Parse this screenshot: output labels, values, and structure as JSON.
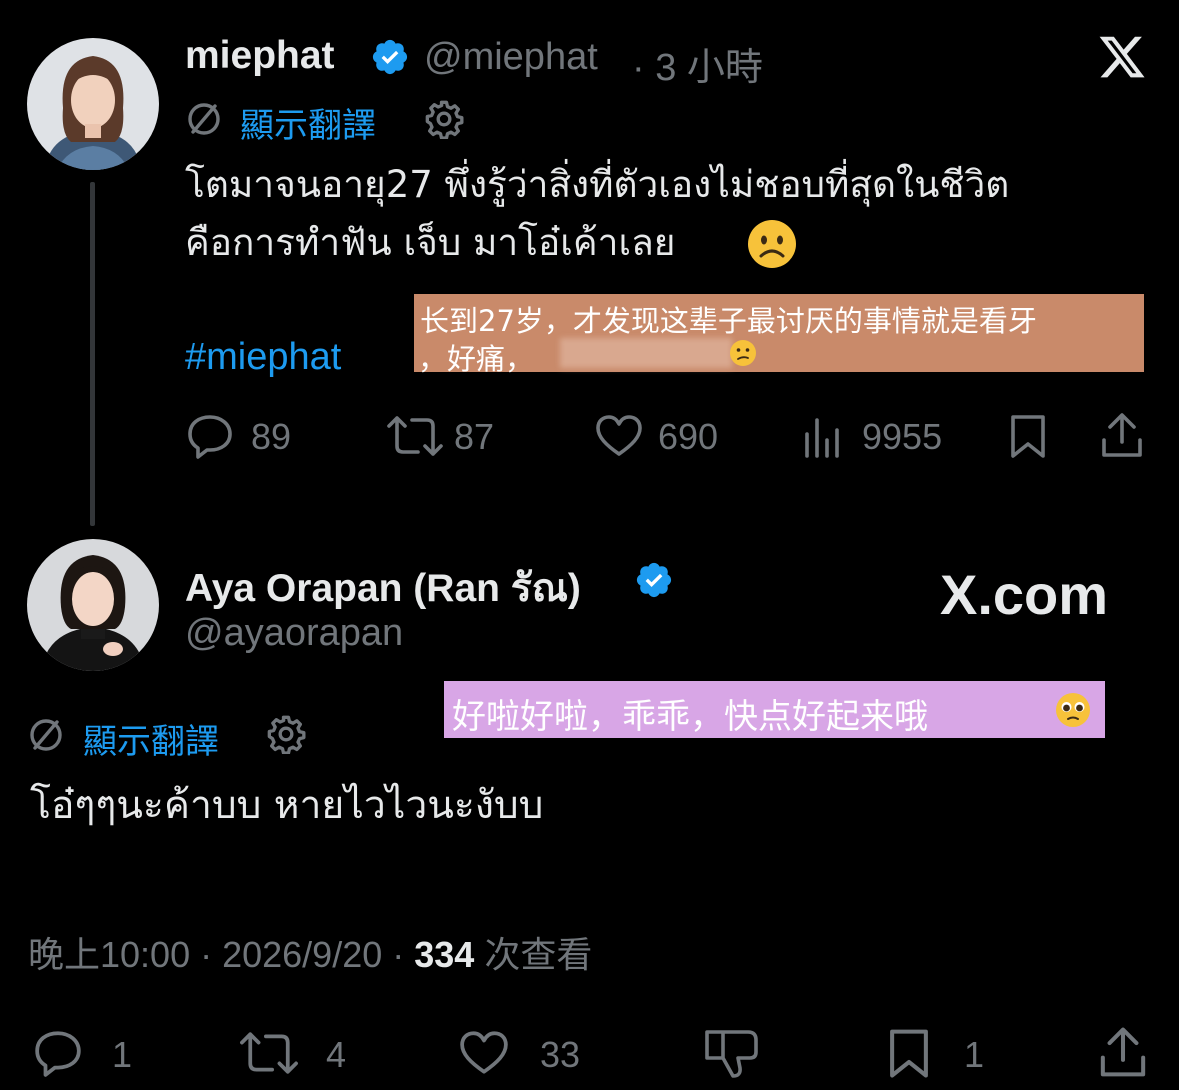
{
  "tweet": {
    "name": "miephat",
    "handle": "@miephat",
    "time": "· 3 小時",
    "translate_label": "顯示翻譯",
    "text_line1": "โตมาจนอายุ27 พึ่งรู้ว่าสิ่งที่ตัวเองไม่ชอบที่สุดในชีวิต",
    "text_line2": "คือการทำฟัน เจ็บ มาโอ๋เค้าเลย",
    "emoji": "☹",
    "hashtag": "#miephat",
    "overlay_line1": "长到27岁，才发现这辈子最讨厌的事情就是看牙",
    "overlay_line2": "，好痛，",
    "overlay_emoji": "🙁",
    "counts": {
      "replies": "89",
      "retweets": "87",
      "likes": "690",
      "views": "9955"
    }
  },
  "reply": {
    "name": "Aya Orapan (Ran รัณ)",
    "handle": "@ayaorapan",
    "watermark": "X.com",
    "overlay": "好啦好啦，乖乖，快点好起来哦",
    "overlay_emoji": "🥺",
    "translate_label": "顯示翻譯",
    "text": "โอ๋ๆๆนะค้าบบ หายไวไวนะงับบ",
    "meta_time": "晚上10:00 · 2026/9/20 · ",
    "meta_views": "334",
    "meta_views_label": " 次查看",
    "counts": {
      "replies": "1",
      "retweets": "4",
      "likes": "33",
      "bookmarks": "1"
    }
  },
  "colors": {
    "accent": "#1d9bf0",
    "muted": "#71767b",
    "overlay_orange": "#c98a6a",
    "overlay_purple": "#d8a6e6"
  }
}
